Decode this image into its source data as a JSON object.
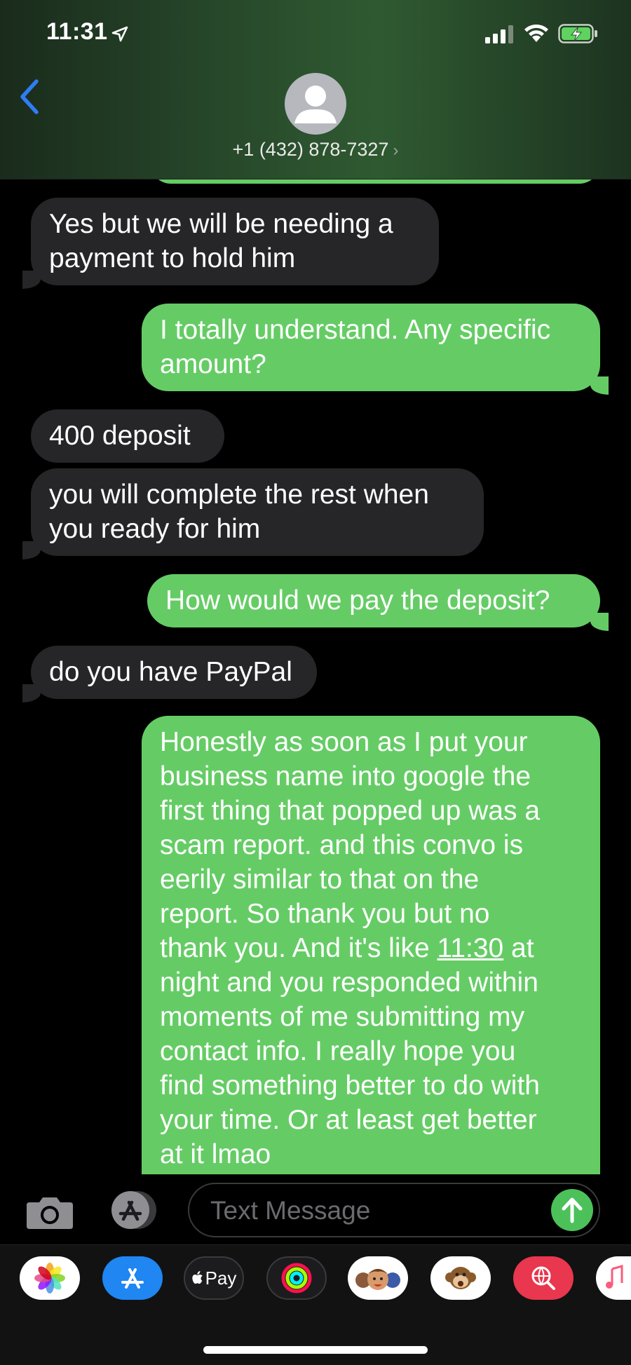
{
  "status_bar": {
    "time": "11:31"
  },
  "header": {
    "contact": "+1 (432) 878-7327",
    "chevron": "›"
  },
  "messages": [
    {
      "dir": "in",
      "text": "Yes but we will be needing a\npayment to hold him"
    },
    {
      "dir": "out",
      "text": "I totally understand. Any specific\namount?"
    },
    {
      "dir": "in",
      "text": "400 deposit"
    },
    {
      "dir": "in",
      "text": "you will complete the rest when\nyou ready for him"
    },
    {
      "dir": "out",
      "text": "How would we pay the deposit?"
    },
    {
      "dir": "in",
      "text": "do you have PayPal"
    },
    {
      "dir": "out",
      "text_before": "Honestly as soon as I put your\nbusiness name into google the\nfirst thing that popped up was a\nscam report. and this convo is\neerily similar to that on the\nreport. So thank you but no\nthank you. And it's like ",
      "link": "11:30",
      "text_after": " at\nnight and you responded within\nmoments of me submitting my\ncontact info. I really hope you\nfind something better to do with\nyour time. Or at least get better\nat it lmao"
    }
  ],
  "input": {
    "placeholder": "Text Message"
  },
  "apps": [
    {
      "name": "photos",
      "bg": "#ffffff"
    },
    {
      "name": "app-store",
      "bg": "#1f86f2"
    },
    {
      "name": "apple-pay",
      "bg": "#1c1c1e",
      "label": "Pay"
    },
    {
      "name": "activity",
      "bg": "#1c1c1e"
    },
    {
      "name": "memoji",
      "bg": "#ffffff"
    },
    {
      "name": "animoji",
      "bg": "#ffffff"
    },
    {
      "name": "web-search",
      "bg": "#e8374e"
    },
    {
      "name": "music",
      "bg": "#ffffff"
    }
  ],
  "colors": {
    "incoming": "#262628",
    "outgoing": "#65cc65",
    "accent": "#2f7cf6"
  }
}
